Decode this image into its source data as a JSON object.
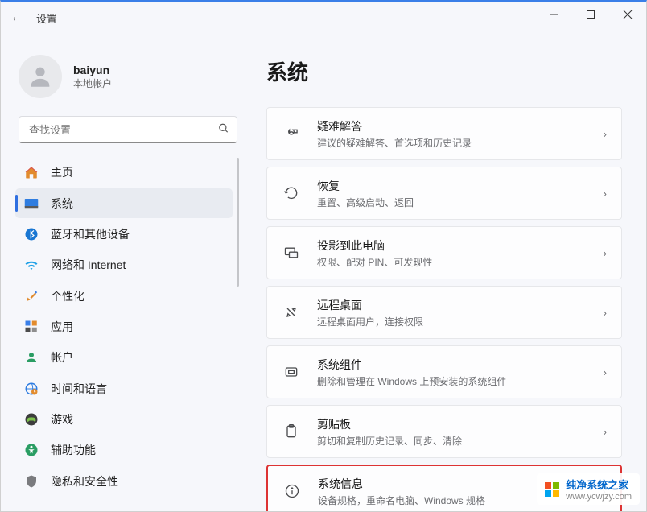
{
  "window": {
    "title": "设置",
    "back_icon": "←"
  },
  "user": {
    "name": "baiyun",
    "account_type": "本地帐户"
  },
  "search": {
    "placeholder": "查找设置"
  },
  "nav": [
    {
      "id": "home",
      "label": "主页",
      "active": false
    },
    {
      "id": "system",
      "label": "系统",
      "active": true
    },
    {
      "id": "bluetooth",
      "label": "蓝牙和其他设备",
      "active": false
    },
    {
      "id": "network",
      "label": "网络和 Internet",
      "active": false
    },
    {
      "id": "personalization",
      "label": "个性化",
      "active": false
    },
    {
      "id": "apps",
      "label": "应用",
      "active": false
    },
    {
      "id": "accounts",
      "label": "帐户",
      "active": false
    },
    {
      "id": "time",
      "label": "时间和语言",
      "active": false
    },
    {
      "id": "gaming",
      "label": "游戏",
      "active": false
    },
    {
      "id": "accessibility",
      "label": "辅助功能",
      "active": false
    },
    {
      "id": "privacy",
      "label": "隐私和安全性",
      "active": false
    }
  ],
  "main": {
    "heading": "系统",
    "cards": [
      {
        "title": "疑难解答",
        "sub": "建议的疑难解答、首选项和历史记录"
      },
      {
        "title": "恢复",
        "sub": "重置、高级启动、返回"
      },
      {
        "title": "投影到此电脑",
        "sub": "权限、配对 PIN、可发现性"
      },
      {
        "title": "远程桌面",
        "sub": "远程桌面用户，连接权限"
      },
      {
        "title": "系统组件",
        "sub": "删除和管理在 Windows 上预安装的系统组件"
      },
      {
        "title": "剪贴板",
        "sub": "剪切和复制历史记录、同步、清除"
      },
      {
        "title": "系统信息",
        "sub": "设备规格，重命名电脑、Windows 规格"
      }
    ]
  },
  "watermark": {
    "brand": "纯净系统之家",
    "url": "www.ycwjzy.com"
  }
}
